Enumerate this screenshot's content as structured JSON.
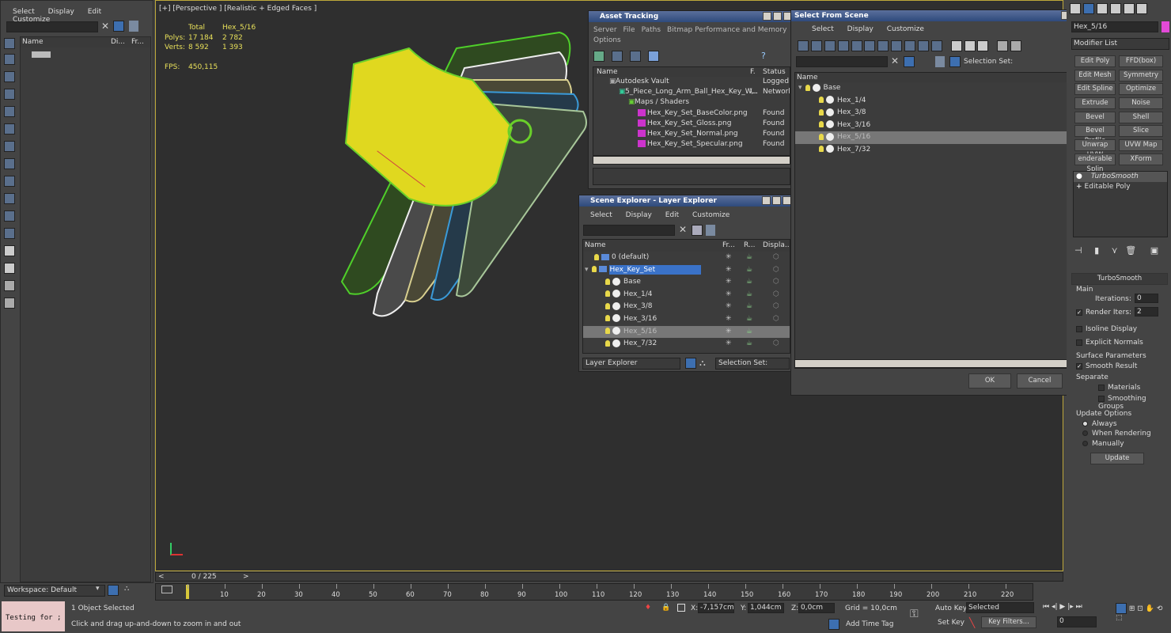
{
  "left_panel": {
    "menu": [
      "Select",
      "Display",
      "Edit",
      "Customize"
    ],
    "col_name": "Name",
    "col_di": "Di...",
    "col_fr": "Fr...",
    "workspace": "Workspace: Default"
  },
  "viewport": {
    "label": "[+] [Perspective ] [Realistic + Edged Faces ]",
    "stats_total": "Total",
    "stats_obj": "Hex_5/16",
    "polys_label": "Polys:",
    "polys_total": "17 184",
    "polys_obj": "2 782",
    "verts_label": "Verts:",
    "verts_total": "8 592",
    "verts_obj": "1 393",
    "fps_label": "FPS:",
    "fps_value": "450,115"
  },
  "asset_tracking": {
    "title": "Asset Tracking",
    "menu": [
      "Server",
      "File",
      "Paths",
      "Bitmap Performance and Memory",
      "Options"
    ],
    "col_name": "Name",
    "col_f": "F.",
    "col_status": "Status",
    "rows": [
      {
        "name": "Autodesk Vault",
        "f": "",
        "status": "Logged O"
      },
      {
        "name": "5_Piece_Long_Arm_Ball_Hex_Key_W...",
        "f": "\\..",
        "status": "Network"
      },
      {
        "name": "Maps / Shaders",
        "f": "",
        "status": ""
      },
      {
        "name": "Hex_Key_Set_BaseColor.png",
        "f": "",
        "status": "Found"
      },
      {
        "name": "Hex_Key_Set_Gloss.png",
        "f": "",
        "status": "Found"
      },
      {
        "name": "Hex_Key_Set_Normal.png",
        "f": "",
        "status": "Found"
      },
      {
        "name": "Hex_Key_Set_Specular.png",
        "f": "",
        "status": "Found"
      }
    ]
  },
  "scene_explorer": {
    "title": "Scene Explorer - Layer Explorer",
    "menu": [
      "Select",
      "Display",
      "Edit",
      "Customize"
    ],
    "col_name": "Name",
    "col_fr": "Fr...",
    "col_r": "R...",
    "col_disp": "Displa...",
    "rows": [
      "0 (default)",
      "Hex_Key_Set",
      "Base",
      "Hex_1/4",
      "Hex_3/8",
      "Hex_3/16",
      "Hex_5/16",
      "Hex_7/32"
    ],
    "footer_dropdown": "Layer Explorer",
    "selection_set": "Selection Set:"
  },
  "select_from_scene": {
    "title": "Select From Scene",
    "menu": [
      "Select",
      "Display",
      "Customize"
    ],
    "selection_set": "Selection Set:",
    "col_name": "Name",
    "rows": [
      "Base",
      "Hex_1/4",
      "Hex_3/8",
      "Hex_3/16",
      "Hex_5/16",
      "Hex_7/32"
    ],
    "ok": "OK",
    "cancel": "Cancel"
  },
  "command_panel": {
    "object_name": "Hex_5/16",
    "modifier_list": "Modifier List",
    "buttons": [
      "Edit Poly",
      "FFD(box)",
      "Edit Mesh",
      "Symmetry",
      "Edit Spline",
      "Optimize",
      "Extrude",
      "Noise",
      "Bevel",
      "Shell",
      "Bevel Profile",
      "Slice",
      "Unwrap UVW",
      "UVW Map",
      "enderable Splin",
      "XForm"
    ],
    "stack": [
      "TurboSmooth",
      "Editable Poly"
    ],
    "rollout_title": "TurboSmooth",
    "main_label": "Main",
    "iterations_label": "Iterations:",
    "iterations_value": "0",
    "render_iters_label": "Render Iters:",
    "render_iters_value": "2",
    "isoline": "Isoline Display",
    "explicit": "Explicit Normals",
    "surface_params": "Surface Parameters",
    "smooth_result": "Smooth Result",
    "separate": "Separate",
    "materials": "Materials",
    "smoothing_groups": "Smoothing Groups",
    "update_options": "Update Options",
    "always": "Always",
    "when_rendering": "When Rendering",
    "manually": "Manually",
    "update_btn": "Update"
  },
  "timeline": {
    "frame": "0 / 225",
    "ticks": [
      "0",
      "10",
      "20",
      "30",
      "40",
      "50",
      "60",
      "70",
      "80",
      "90",
      "100",
      "110",
      "120",
      "130",
      "140",
      "150",
      "160",
      "170",
      "180",
      "190",
      "200",
      "210",
      "220"
    ]
  },
  "status": {
    "script": "Testing for ;",
    "selected": "1 Object Selected",
    "hint": "Click and drag up-and-down to zoom in and out",
    "x_label": "X:",
    "x_value": "-7,157cm",
    "y_label": "Y:",
    "y_value": "1,044cm",
    "z_label": "Z:",
    "z_value": "0,0cm",
    "grid": "Grid = 10,0cm",
    "add_time_tag": "Add Time Tag",
    "auto_key": "Auto Key",
    "selected_dd": "Selected",
    "set_key": "Set Key",
    "key_filters": "Key Filters...",
    "frame_field": "0"
  }
}
